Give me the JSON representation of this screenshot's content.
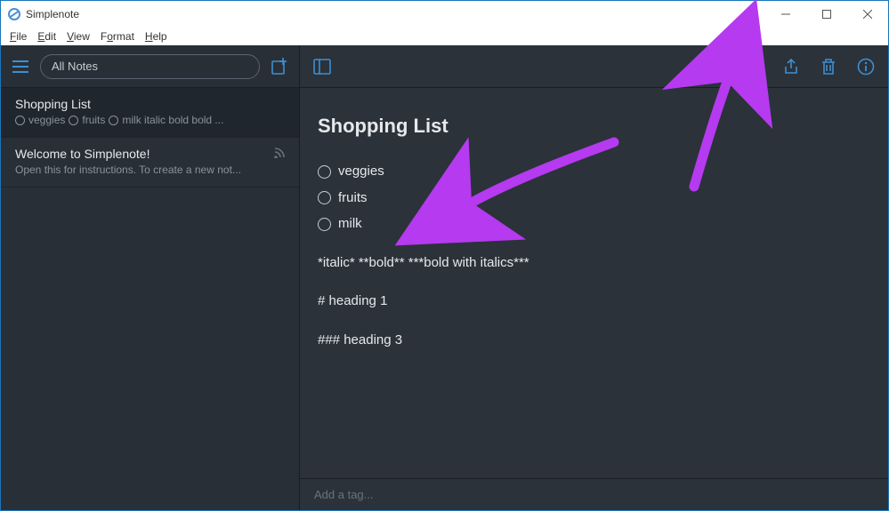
{
  "window": {
    "title": "Simplenote"
  },
  "menubar": {
    "file": "File",
    "edit": "Edit",
    "view": "View",
    "format": "Format",
    "help": "Help"
  },
  "sidebar": {
    "search_placeholder": "All Notes",
    "notes": [
      {
        "title": "Shopping List",
        "preview_items": [
          "veggies",
          "fruits",
          "milk italic bold bold ..."
        ],
        "active": true
      },
      {
        "title": "Welcome to Simplenote!",
        "preview": "Open this for instructions. To create a new not...",
        "active": false,
        "has_feed": true
      }
    ]
  },
  "editor": {
    "title": "Shopping List",
    "checklist": [
      "veggies",
      "fruits",
      "milk"
    ],
    "body_line1": "*italic*   **bold**   ***bold with italics***",
    "body_line2": "# heading 1",
    "body_line3": "### heading 3",
    "tag_placeholder": "Add a tag..."
  },
  "colors": {
    "accent": "#3e8fd1",
    "arrow": "#b53af0"
  }
}
